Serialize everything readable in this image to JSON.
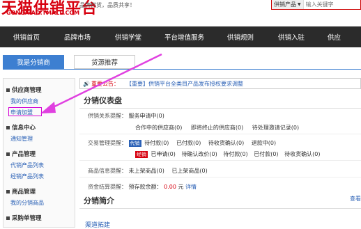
{
  "header": {
    "logo": "天猫供销平台",
    "logo_sub": "GONGXIAO.TMALL.COM",
    "slogan": "品牌供货，品质共享！",
    "search_type": "供销产品",
    "search_placeholder": "输入关键字"
  },
  "nav": [
    "供销首页",
    "品牌市场",
    "供销学堂",
    "平台增值服务",
    "供销规则",
    "供销入驻",
    "供应"
  ],
  "tabs": [
    "我是分销商",
    "货源推荐"
  ],
  "sidebar": [
    {
      "title": "供应商管理",
      "links": [
        "我的供应商",
        "申请加盟"
      ]
    },
    {
      "title": "信息中心",
      "links": [
        "通知管理"
      ]
    },
    {
      "title": "产品管理",
      "links": [
        "代销产品列表",
        "经销产品列表"
      ]
    },
    {
      "title": "商品管理",
      "links": [
        "我的分销商品"
      ]
    },
    {
      "title": "采购单管理",
      "links": []
    }
  ],
  "notice": {
    "label": "重要公告：",
    "text": "【重要】供销平台全类目产品发布授权要求调整"
  },
  "dashboard": {
    "title": "分销仪表盘",
    "supply_label": "供销关系提醒：",
    "supply_row1": "服务申请中(0)",
    "supply_row2": [
      "合作中的供应商(0)",
      "即将终止的供应商(0)",
      "待处理邀请记录(0)"
    ],
    "trade_label": "交易管理提醒：",
    "trade_badge1": "代销",
    "trade_row1": [
      "待付款(0)",
      "已付款(0)",
      "待收货确认(0)",
      "退款中(0)"
    ],
    "trade_badge2": "经销",
    "trade_row2": [
      "已申请(0)",
      "待确认改价(0)",
      "待付款(0)",
      "已付款(0)",
      "待收货确认(0)"
    ],
    "goods_label": "商品信息提醒：",
    "goods_row": [
      "未上架商品(0)",
      "已上架商品(0)"
    ],
    "fund_label": "资金结算提醒：",
    "fund_prefix": "预存款余额：",
    "fund_amount": "0.00",
    "fund_unit": "元",
    "fund_detail": "详情"
  },
  "intro": {
    "title": "分销简介",
    "more": "查看",
    "sub": "渠道拓建"
  }
}
